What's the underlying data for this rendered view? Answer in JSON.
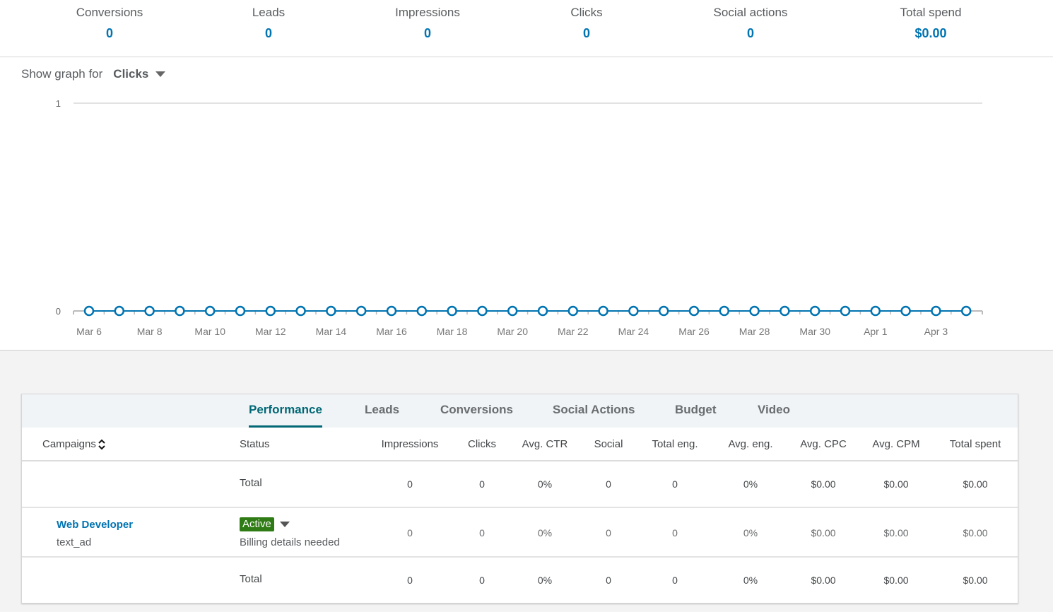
{
  "kpis": [
    {
      "label": "Conversions",
      "value": "0"
    },
    {
      "label": "Leads",
      "value": "0"
    },
    {
      "label": "Impressions",
      "value": "0"
    },
    {
      "label": "Clicks",
      "value": "0"
    },
    {
      "label": "Social actions",
      "value": "0"
    },
    {
      "label": "Total spend",
      "value": "$0.00"
    }
  ],
  "graph_selector": {
    "label": "Show graph for",
    "selected": "Clicks"
  },
  "chart_data": {
    "type": "line",
    "title": "",
    "xlabel": "",
    "ylabel": "",
    "ylim": [
      0,
      1
    ],
    "yticks": [
      "0",
      "1"
    ],
    "grid": true,
    "x": [
      "Mar 6",
      "Mar 7",
      "Mar 8",
      "Mar 9",
      "Mar 10",
      "Mar 11",
      "Mar 12",
      "Mar 13",
      "Mar 14",
      "Mar 15",
      "Mar 16",
      "Mar 17",
      "Mar 18",
      "Mar 19",
      "Mar 20",
      "Mar 21",
      "Mar 22",
      "Mar 23",
      "Mar 24",
      "Mar 25",
      "Mar 26",
      "Mar 27",
      "Mar 28",
      "Mar 29",
      "Mar 30",
      "Mar 31",
      "Apr 1",
      "Apr 2",
      "Apr 3",
      "Apr 4"
    ],
    "xtick_labels": [
      "Mar 6",
      "Mar 8",
      "Mar 10",
      "Mar 12",
      "Mar 14",
      "Mar 16",
      "Mar 18",
      "Mar 20",
      "Mar 22",
      "Mar 24",
      "Mar 26",
      "Mar 28",
      "Mar 30",
      "Apr 1",
      "Apr 3"
    ],
    "series": [
      {
        "name": "Clicks",
        "color": "#0073b1",
        "values": [
          0,
          0,
          0,
          0,
          0,
          0,
          0,
          0,
          0,
          0,
          0,
          0,
          0,
          0,
          0,
          0,
          0,
          0,
          0,
          0,
          0,
          0,
          0,
          0,
          0,
          0,
          0,
          0,
          0,
          0
        ]
      }
    ]
  },
  "tabs": [
    {
      "label": "Performance",
      "active": true
    },
    {
      "label": "Leads",
      "active": false
    },
    {
      "label": "Conversions",
      "active": false
    },
    {
      "label": "Social Actions",
      "active": false
    },
    {
      "label": "Budget",
      "active": false
    },
    {
      "label": "Video",
      "active": false
    }
  ],
  "table": {
    "headers": {
      "campaigns": "Campaigns",
      "status": "Status",
      "metrics": [
        "Impressions",
        "Clicks",
        "Avg. CTR",
        "Social",
        "Total eng.",
        "Avg. eng.",
        "Avg. CPC",
        "Avg. CPM",
        "Total spent"
      ]
    },
    "top_total": {
      "label": "Total",
      "values": [
        "0",
        "0",
        "0%",
        "0",
        "0",
        "0%",
        "$0.00",
        "$0.00",
        "$0.00"
      ]
    },
    "rows": [
      {
        "name": "Web Developer",
        "type": "text_ad",
        "status": "Active",
        "status_note": "Billing details needed",
        "values": [
          "0",
          "0",
          "0%",
          "0",
          "0",
          "0%",
          "$0.00",
          "$0.00",
          "$0.00"
        ]
      }
    ],
    "bottom_total": {
      "label": "Total",
      "values": [
        "0",
        "0",
        "0%",
        "0",
        "0",
        "0%",
        "$0.00",
        "$0.00",
        "$0.00"
      ]
    }
  },
  "colors": {
    "accent": "#0073b1",
    "tab_active": "#006775",
    "status_active": "#2f7b15"
  }
}
